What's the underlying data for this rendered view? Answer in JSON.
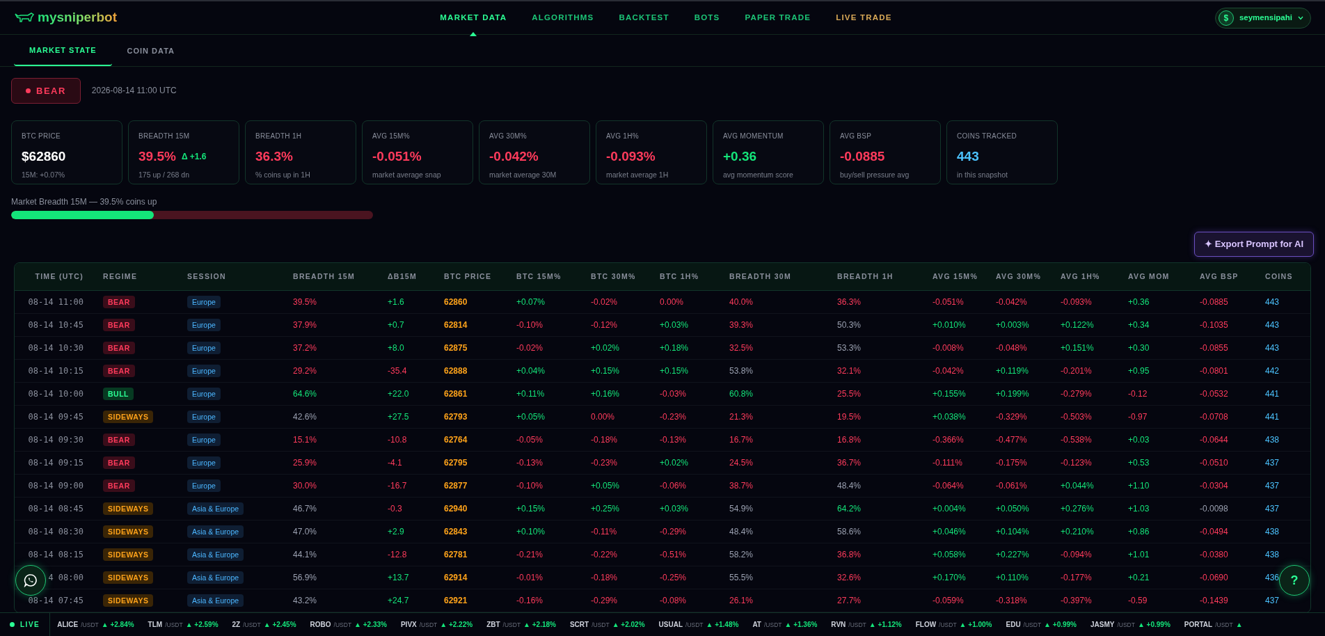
{
  "brand": {
    "name": "mysniperbot"
  },
  "nav": [
    {
      "label": "MARKET DATA",
      "selected": true,
      "kind": "normal"
    },
    {
      "label": "ALGORITHMS",
      "selected": false,
      "kind": "normal"
    },
    {
      "label": "BACKTEST",
      "selected": false,
      "kind": "normal"
    },
    {
      "label": "BOTS",
      "selected": false,
      "kind": "normal"
    },
    {
      "label": "PAPER TRADE",
      "selected": false,
      "kind": "normal"
    },
    {
      "label": "LIVE TRADE",
      "selected": false,
      "kind": "live"
    }
  ],
  "user": {
    "avatar": "$",
    "name": "seymensipahi"
  },
  "tabs": [
    {
      "label": "MARKET STATE",
      "selected": true
    },
    {
      "label": "COIN DATA",
      "selected": false
    }
  ],
  "regime": {
    "label": "BEAR",
    "kind": "bear",
    "timestamp": "2026-08-14 11:00 UTC"
  },
  "stats": [
    {
      "label": "BTC PRICE",
      "value": "$62860",
      "color": "#ffffff",
      "sub": "15M: +0.07%"
    },
    {
      "label": "BREADTH 15M",
      "value": "39.5%",
      "color": "#ff3b5c",
      "delta": "Δ +1.6",
      "sub": "175 up / 268 dn"
    },
    {
      "label": "BREADTH 1H",
      "value": "36.3%",
      "color": "#ff3b5c",
      "sub": "% coins up in 1H"
    },
    {
      "label": "AVG 15M%",
      "value": "-0.051%",
      "color": "#ff3b5c",
      "sub": "market average snap"
    },
    {
      "label": "AVG 30M%",
      "value": "-0.042%",
      "color": "#ff3b5c",
      "sub": "market average 30M"
    },
    {
      "label": "AVG 1H%",
      "value": "-0.093%",
      "color": "#ff3b5c",
      "sub": "market average 1H"
    },
    {
      "label": "AVG MOMENTUM",
      "value": "+0.36",
      "color": "#14e57a",
      "sub": "avg momentum score"
    },
    {
      "label": "AVG BSP",
      "value": "-0.0885",
      "color": "#ff3b5c",
      "sub": "buy/sell pressure avg"
    },
    {
      "label": "COINS TRACKED",
      "value": "443",
      "color": "#4cc3ff",
      "sub": "in this snapshot"
    }
  ],
  "breadth_bar": {
    "label": "Market Breadth 15M — 39.5% coins up",
    "level": 0.395
  },
  "export_button": {
    "icon": "✦",
    "label": "Export Prompt for AI"
  },
  "table": {
    "columns": [
      "TIME (UTC)",
      "REGIME",
      "SESSION",
      "BREADTH 15M",
      "ΔB15M",
      "BTC PRICE",
      "BTC 15M%",
      "BTC 30M%",
      "BTC 1H%",
      "BREADTH 30M",
      "BREADTH 1H",
      "AVG 15M%",
      "AVG 30M%",
      "AVG 1H%",
      "AVG MOM",
      "AVG BSP",
      "COINS"
    ],
    "rows": [
      {
        "time": "08-14 11:00",
        "regime": {
          "label": "BEAR",
          "kind": "bear"
        },
        "session": "Europe",
        "values": [
          "39.5%",
          "+1.6",
          "62860",
          "+0.07%",
          "-0.02%",
          "0.00%",
          "40.0%",
          "36.3%",
          "-0.051%",
          "-0.042%",
          "-0.093%",
          "+0.36",
          "-0.0885",
          "443"
        ]
      },
      {
        "time": "08-14 10:45",
        "regime": {
          "label": "BEAR",
          "kind": "bear"
        },
        "session": "Europe",
        "values": [
          "37.9%",
          "+0.7",
          "62814",
          "-0.10%",
          "-0.12%",
          "+0.03%",
          "39.3%",
          "50.3%",
          "+0.010%",
          "+0.003%",
          "+0.122%",
          "+0.34",
          "-0.1035",
          "443"
        ]
      },
      {
        "time": "08-14 10:30",
        "regime": {
          "label": "BEAR",
          "kind": "bear"
        },
        "session": "Europe",
        "values": [
          "37.2%",
          "+8.0",
          "62875",
          "-0.02%",
          "+0.02%",
          "+0.18%",
          "32.5%",
          "53.3%",
          "-0.008%",
          "-0.048%",
          "+0.151%",
          "+0.30",
          "-0.0855",
          "443"
        ]
      },
      {
        "time": "08-14 10:15",
        "regime": {
          "label": "BEAR",
          "kind": "bear"
        },
        "session": "Europe",
        "values": [
          "29.2%",
          "-35.4",
          "62888",
          "+0.04%",
          "+0.15%",
          "+0.15%",
          "53.8%",
          "32.1%",
          "-0.042%",
          "+0.119%",
          "-0.201%",
          "+0.95",
          "-0.0801",
          "442"
        ]
      },
      {
        "time": "08-14 10:00",
        "regime": {
          "label": "BULL",
          "kind": "bull"
        },
        "session": "Europe",
        "values": [
          "64.6%",
          "+22.0",
          "62861",
          "+0.11%",
          "+0.16%",
          "-0.03%",
          "60.8%",
          "25.5%",
          "+0.155%",
          "+0.199%",
          "-0.279%",
          "-0.12",
          "-0.0532",
          "441"
        ]
      },
      {
        "time": "08-14 09:45",
        "regime": {
          "label": "SIDEWAYS",
          "kind": "sideways"
        },
        "session": "Europe",
        "values": [
          "42.6%",
          "+27.5",
          "62793",
          "+0.05%",
          "0.00%",
          "-0.23%",
          "21.3%",
          "19.5%",
          "+0.038%",
          "-0.329%",
          "-0.503%",
          "-0.97",
          "-0.0708",
          "441"
        ]
      },
      {
        "time": "08-14 09:30",
        "regime": {
          "label": "BEAR",
          "kind": "bear"
        },
        "session": "Europe",
        "values": [
          "15.1%",
          "-10.8",
          "62764",
          "-0.05%",
          "-0.18%",
          "-0.13%",
          "16.7%",
          "16.8%",
          "-0.366%",
          "-0.477%",
          "-0.538%",
          "+0.03",
          "-0.0644",
          "438"
        ]
      },
      {
        "time": "08-14 09:15",
        "regime": {
          "label": "BEAR",
          "kind": "bear"
        },
        "session": "Europe",
        "values": [
          "25.9%",
          "-4.1",
          "62795",
          "-0.13%",
          "-0.23%",
          "+0.02%",
          "24.5%",
          "36.7%",
          "-0.111%",
          "-0.175%",
          "-0.123%",
          "+0.53",
          "-0.0510",
          "437"
        ]
      },
      {
        "time": "08-14 09:00",
        "regime": {
          "label": "BEAR",
          "kind": "bear"
        },
        "session": "Europe",
        "values": [
          "30.0%",
          "-16.7",
          "62877",
          "-0.10%",
          "+0.05%",
          "-0.06%",
          "38.7%",
          "48.4%",
          "-0.064%",
          "-0.061%",
          "+0.044%",
          "+1.10",
          "-0.0304",
          "437"
        ]
      },
      {
        "time": "08-14 08:45",
        "regime": {
          "label": "SIDEWAYS",
          "kind": "sideways"
        },
        "session": "Asia & Europe",
        "values": [
          "46.7%",
          "-0.3",
          "62940",
          "+0.15%",
          "+0.25%",
          "+0.03%",
          "54.9%",
          "64.2%",
          "+0.004%",
          "+0.050%",
          "+0.276%",
          "+1.03",
          "-0.0098",
          "437"
        ]
      },
      {
        "time": "08-14 08:30",
        "regime": {
          "label": "SIDEWAYS",
          "kind": "sideways"
        },
        "session": "Asia & Europe",
        "values": [
          "47.0%",
          "+2.9",
          "62843",
          "+0.10%",
          "-0.11%",
          "-0.29%",
          "48.4%",
          "58.6%",
          "+0.046%",
          "+0.104%",
          "+0.210%",
          "+0.86",
          "-0.0494",
          "438"
        ]
      },
      {
        "time": "08-14 08:15",
        "regime": {
          "label": "SIDEWAYS",
          "kind": "sideways"
        },
        "session": "Asia & Europe",
        "values": [
          "44.1%",
          "-12.8",
          "62781",
          "-0.21%",
          "-0.22%",
          "-0.51%",
          "58.2%",
          "36.8%",
          "+0.058%",
          "+0.227%",
          "-0.094%",
          "+1.01",
          "-0.0380",
          "438"
        ]
      },
      {
        "time": "4 08:00",
        "regime": {
          "label": "SIDEWAYS",
          "kind": "sideways"
        },
        "session": "Asia & Europe",
        "values": [
          "56.9%",
          "+13.7",
          "62914",
          "-0.01%",
          "-0.18%",
          "-0.25%",
          "55.5%",
          "32.6%",
          "+0.170%",
          "+0.110%",
          "-0.177%",
          "+0.21",
          "-0.0690",
          "436"
        ]
      },
      {
        "time": "08-14 07:45",
        "regime": {
          "label": "SIDEWAYS",
          "kind": "sideways"
        },
        "session": "Asia & Europe",
        "values": [
          "43.2%",
          "+24.7",
          "62921",
          "-0.16%",
          "-0.29%",
          "-0.08%",
          "26.1%",
          "27.7%",
          "-0.059%",
          "-0.318%",
          "-0.397%",
          "-0.59",
          "-0.1439",
          "437"
        ]
      }
    ]
  },
  "help_button": {
    "label": "?"
  },
  "ticker": {
    "live_label": "LIVE",
    "items": [
      {
        "symbol": "ALICE",
        "quote": "/USDT",
        "change": "▲ +2.84%"
      },
      {
        "symbol": "TLM",
        "quote": "/USDT",
        "change": "▲ +2.59%"
      },
      {
        "symbol": "2Z",
        "quote": "/USDT",
        "change": "▲ +2.45%"
      },
      {
        "symbol": "ROBO",
        "quote": "/USDT",
        "change": "▲ +2.33%"
      },
      {
        "symbol": "PIVX",
        "quote": "/USDT",
        "change": "▲ +2.22%"
      },
      {
        "symbol": "ZBT",
        "quote": "/USDT",
        "change": "▲ +2.18%"
      },
      {
        "symbol": "SCRT",
        "quote": "/USDT",
        "change": "▲ +2.02%"
      },
      {
        "symbol": "USUAL",
        "quote": "/USDT",
        "change": "▲ +1.48%"
      },
      {
        "symbol": "AT",
        "quote": "/USDT",
        "change": "▲ +1.36%"
      },
      {
        "symbol": "RVN",
        "quote": "/USDT",
        "change": "▲ +1.12%"
      },
      {
        "symbol": "FLOW",
        "quote": "/USDT",
        "change": "▲ +1.00%"
      },
      {
        "symbol": "EDU",
        "quote": "/USDT",
        "change": "▲ +0.99%"
      },
      {
        "symbol": "JASMY",
        "quote": "/USDT",
        "change": "▲ +0.99%"
      },
      {
        "symbol": "PORTAL",
        "quote": "/USDT",
        "change": "▲"
      }
    ]
  }
}
